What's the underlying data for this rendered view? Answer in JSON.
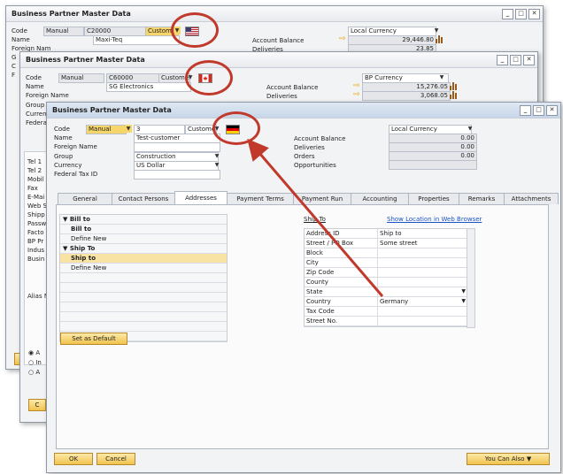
{
  "back_window": {
    "title": "Business Partner Master Data",
    "code_label": "Code",
    "series": "Manual",
    "code": "C20000",
    "bp_type": "Customer",
    "name_label": "Name",
    "name": "Maxi-Teq",
    "foreign_name_label": "Foreign Nam",
    "currency_field": "Local Currency",
    "account_balance_label": "Account Balance",
    "account_balance": "29,446.80",
    "deliveries_label": "Deliveries",
    "deliveries": "23.85",
    "left_letters": [
      "G",
      "C",
      "F"
    ],
    "ok_label": "O"
  },
  "middle_window": {
    "title": "Business Partner Master Data",
    "code_label": "Code",
    "series": "Manual",
    "code": "C60000",
    "bp_type": "Customer",
    "name_label": "Name",
    "name": "SG Electronics",
    "foreign_name_label": "Foreign Name",
    "currency_field": "BP Currency",
    "account_balance_label": "Account Balance",
    "account_balance": "15,276.05",
    "deliveries_label": "Deliveries",
    "deliveries": "3,068.05",
    "left_labels": [
      "Group",
      "Curren",
      "Federa"
    ],
    "side_labels": [
      "Tel 1",
      "Tel 2",
      "Mobil",
      "Fax",
      "E-Mai",
      "Web S",
      "Shipp",
      "Passw",
      "Facto",
      "BP Pr",
      "Indus",
      "Busin"
    ],
    "alias_label": "Alias N",
    "radio_labels": [
      "A",
      "In",
      "A"
    ],
    "ok_label": "C"
  },
  "front_window": {
    "title": "Business Partner Master Data",
    "header": {
      "code_label": "Code",
      "series": "Manual",
      "code": "3",
      "bp_type": "Customer",
      "name_label": "Name",
      "name": "Test-customer",
      "foreign_name_label": "Foreign Name",
      "group_label": "Group",
      "group": "Construction",
      "currency_label": "Currency",
      "currency": "US Dollar",
      "federal_tax_label": "Federal Tax ID",
      "currency_field": "Local Currency",
      "account_balance_label": "Account Balance",
      "account_balance": "0.00",
      "deliveries_label": "Deliveries",
      "deliveries": "0.00",
      "orders_label": "Orders",
      "orders": "0.00",
      "opportunities_label": "Opportunities"
    },
    "tabs": [
      "General",
      "Contact Persons",
      "Addresses",
      "Payment Terms",
      "Payment Run",
      "Accounting",
      "Properties",
      "Remarks",
      "Attachments"
    ],
    "address_list": {
      "bill_to_group": "Bill to",
      "bill_to_item": "Bill to",
      "define_new_1": "Define New",
      "ship_to_group": "Ship To",
      "ship_to_item": "Ship to",
      "define_new_2": "Define New"
    },
    "ship_to_heading": "Ship To",
    "show_location_link": "Show Location in Web Browser",
    "address_fields": [
      {
        "label": "Address ID",
        "value": "Ship to"
      },
      {
        "label": "Street / PO Box",
        "value": "Some street"
      },
      {
        "label": "Block",
        "value": ""
      },
      {
        "label": "City",
        "value": ""
      },
      {
        "label": "Zip Code",
        "value": ""
      },
      {
        "label": "County",
        "value": ""
      },
      {
        "label": "State",
        "value": ""
      },
      {
        "label": "Country",
        "value": "Germany"
      },
      {
        "label": "Tax Code",
        "value": ""
      },
      {
        "label": "Street No.",
        "value": ""
      }
    ],
    "set_as_default": "Set as Default",
    "ok_button": "OK",
    "cancel_button": "Cancel",
    "you_can_also": "You Can Also"
  },
  "window_controls": {
    "minimize": "_",
    "maximize": "□",
    "close": "✕"
  },
  "icons": {
    "dropdown": "chevron-down-icon",
    "arrow": "yellow-arrow-icon",
    "chart": "bar-chart-icon"
  },
  "colors": {
    "highlight_circle": "#c0392b",
    "arrow": "#c0392b",
    "selection": "#f9e3a4",
    "button": "#f1c34e",
    "link": "#1a52c8"
  }
}
